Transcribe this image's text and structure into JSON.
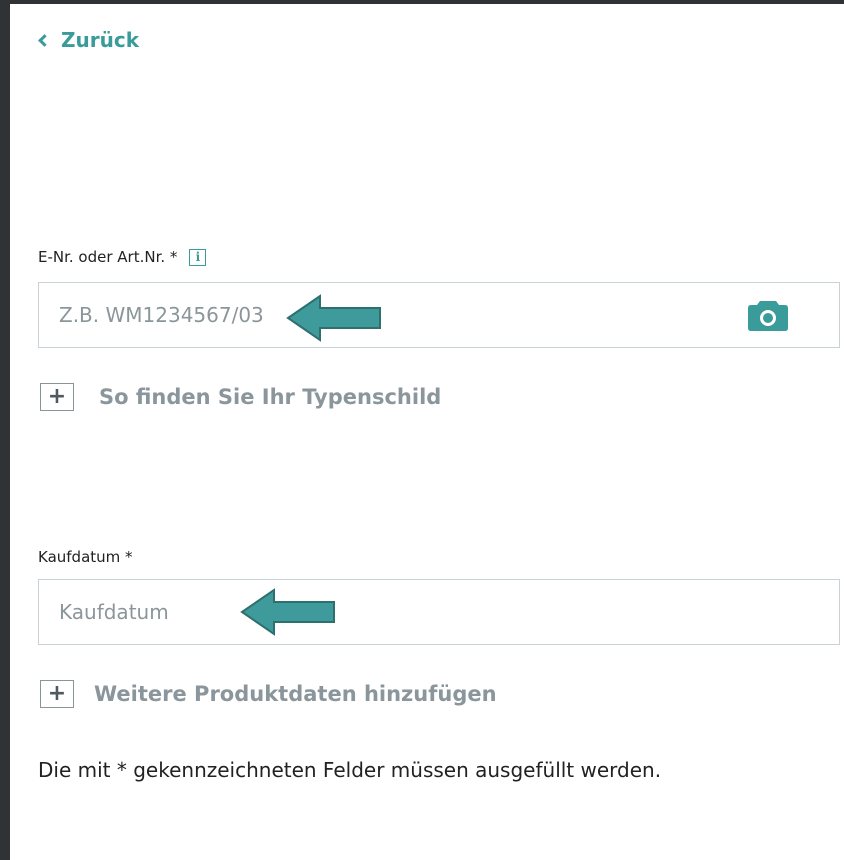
{
  "back": {
    "label": "Zurück"
  },
  "article_field": {
    "label": "E-Nr. oder Art.Nr. *",
    "info_icon": "i",
    "placeholder": "Z.B. WM1234567/03",
    "value": ""
  },
  "typenschild_expander": {
    "icon": "+",
    "label": "So finden Sie Ihr Typenschild"
  },
  "date_field": {
    "label": "Kaufdatum *",
    "placeholder": "Kaufdatum",
    "value": ""
  },
  "more_data_expander": {
    "icon": "+",
    "label": "Weitere Produktdaten hinzufügen"
  },
  "required_note": "Die mit * gekennzeichneten Felder müssen ausgefüllt werden.",
  "colors": {
    "accent": "#3a9b9b",
    "arrow": "#3f9b9b",
    "border": "#c9d2d6",
    "muted_text": "#8a969b"
  },
  "icons": {
    "back": "chevron-left-icon",
    "info": "info-icon",
    "camera": "camera-icon",
    "arrow": "arrow-left-icon",
    "expand": "plus-icon"
  }
}
